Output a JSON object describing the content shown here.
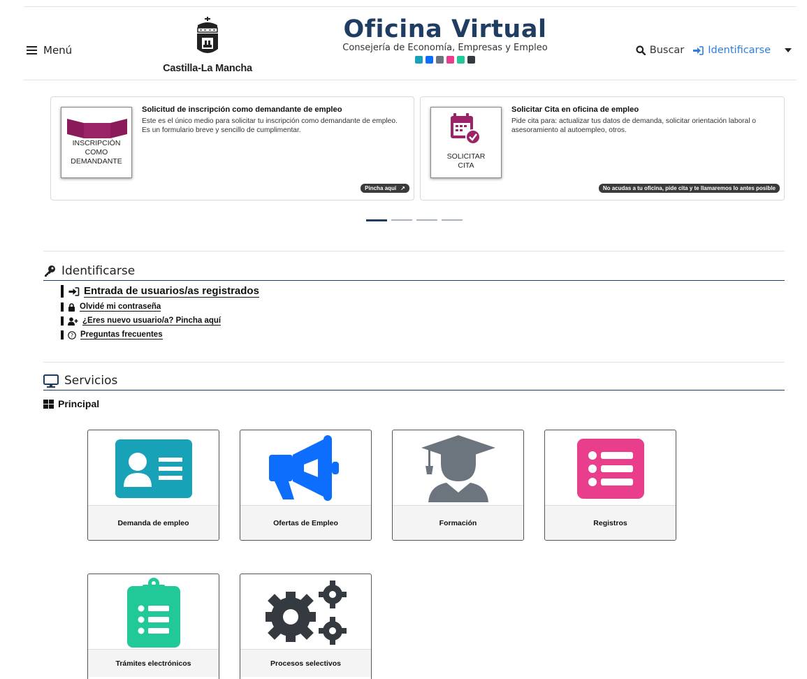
{
  "header": {
    "menu_label": "Menú",
    "logo_text": "Castilla-La Mancha",
    "brand_title": "Oficina Virtual",
    "brand_subtitle": "Consejería de Economía, Empresas y Empleo",
    "brand_icon_colors": [
      "#17a2b8",
      "#0d6efd",
      "#6c757d",
      "#e83e8c",
      "#20c997",
      "#343a40"
    ],
    "search_label": "Buscar",
    "login_label": "Identificarse",
    "accent_color": "#1f3d63",
    "link_color": "#2b7de0"
  },
  "carousel": {
    "cards": [
      {
        "image_caption": "INSCRIPCIÓN COMO DEMANDANTE",
        "image_caption_lines": [
          "INSCRIPCIÓN",
          "COMO",
          "DEMANDANTE"
        ],
        "title": "Solicitud de inscripción como demandante de empleo",
        "description": "Este es el único medio para solicitar tu inscripción como demandante de empleo. Es un formulario breve y sencillo de cumplimentar.",
        "action": "Pincha aquí"
      },
      {
        "image_caption": "SOLICITAR CITA",
        "image_caption_lines": [
          "SOLICITAR",
          "CITA"
        ],
        "title": "Solicitar Cita en oficina de empleo",
        "description": "Pide cita para: actualizar tus datos de demanda, solicitar orientación laboral o asesoramiento al autoempleo, otros.",
        "action": "No acudas a tu oficina, pide cita y te llamaremos lo antes posible"
      }
    ],
    "slide_count": 4,
    "active_slide": 1
  },
  "identificarse": {
    "title": "Identificarse",
    "links": [
      {
        "label": "Entrada de usuarios/as registrados",
        "icon": "sign-in-icon"
      },
      {
        "label": "Olvidé mi contraseña",
        "icon": "lock-icon"
      },
      {
        "label": "¿Eres nuevo usuario/a? Pincha aquí",
        "icon": "user-plus-icon"
      },
      {
        "label": "Preguntas frecuentes",
        "icon": "question-circle-icon"
      }
    ]
  },
  "servicios": {
    "title": "Servicios",
    "group_title": "Principal",
    "tiles": [
      {
        "label": "Demanda de empleo",
        "icon": "id-card-icon",
        "color": "#17a2b8"
      },
      {
        "label": "Ofertas de Empleo",
        "icon": "megaphone-icon",
        "color": "#0d6efd"
      },
      {
        "label": "Formación",
        "icon": "graduate-icon",
        "color": "#6c757d"
      },
      {
        "label": "Registros",
        "icon": "list-icon",
        "color": "#e83e8c"
      },
      {
        "label": "Trámites electrónicos",
        "icon": "clipboard-list-icon",
        "color": "#20c997"
      },
      {
        "label": "Procesos selectivos",
        "icon": "gears-icon",
        "color": "#343a40"
      }
    ]
  }
}
